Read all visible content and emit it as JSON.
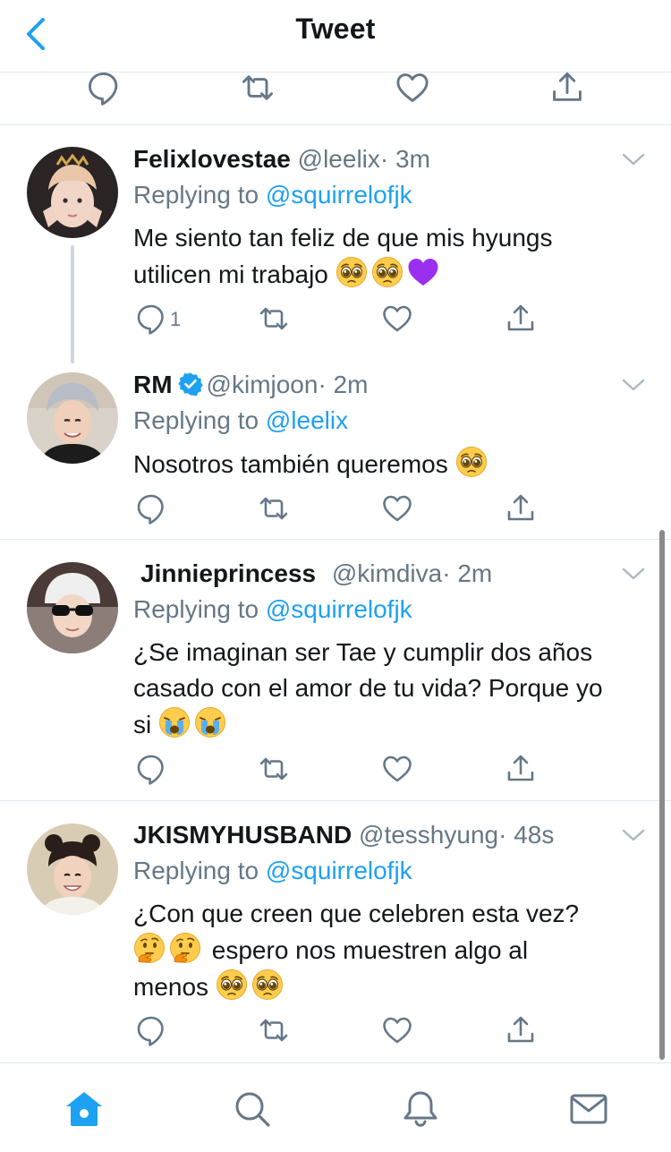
{
  "header": {
    "title": "Tweet"
  },
  "colors": {
    "accent": "#1da1f2",
    "muted": "#657786",
    "text": "#14171a",
    "divider": "#e1e8ed",
    "heart_purple": "#9b2ff0"
  },
  "tweets": [
    {
      "name": "Felixlovestae",
      "handle": "@leelix",
      "time": "· 3m",
      "replying_prefix": "Replying to ",
      "replying_to": "@squirrelofjk",
      "lines": [
        "Me siento tan feliz de que mis hyungs",
        "utilicen mi trabajo "
      ],
      "reply_count": "1",
      "avatar_icon": "avatar-felix"
    },
    {
      "name": "RM",
      "handle": "@kimjoon",
      "time": "· 2m",
      "verified": true,
      "replying_prefix": "Replying to ",
      "replying_to": "@leelix",
      "lines": [
        "Nosotros también queremos "
      ],
      "avatar_icon": "avatar-rm"
    },
    {
      "name": "Jinnieprincess",
      "handle": "@kimdiva",
      "time": "· 2m",
      "replying_prefix": "Replying to ",
      "replying_to": "@squirrelofjk",
      "lines": [
        "¿Se imaginan ser Tae y cumplir dos años",
        "casado con el amor de tu vida? Porque yo",
        "si "
      ],
      "avatar_icon": "avatar-jinnie"
    },
    {
      "name": "JKISMYHUSBAND",
      "handle": "@tesshyung",
      "time": "· 48s",
      "replying_prefix": "Replying to ",
      "replying_to": "@squirrelofjk",
      "lines": [
        "¿Con que creen que celebren esta vez?",
        " espero nos muestren algo al",
        "menos "
      ],
      "avatar_icon": "avatar-jk"
    }
  ],
  "icons": {
    "back": "chevron-left-icon",
    "reply": "reply-icon",
    "retweet": "retweet-icon",
    "like": "heart-icon",
    "share": "share-icon",
    "more": "chevron-down-icon",
    "home": "home-icon",
    "search": "search-icon",
    "notifications": "bell-icon",
    "messages": "mail-icon"
  }
}
